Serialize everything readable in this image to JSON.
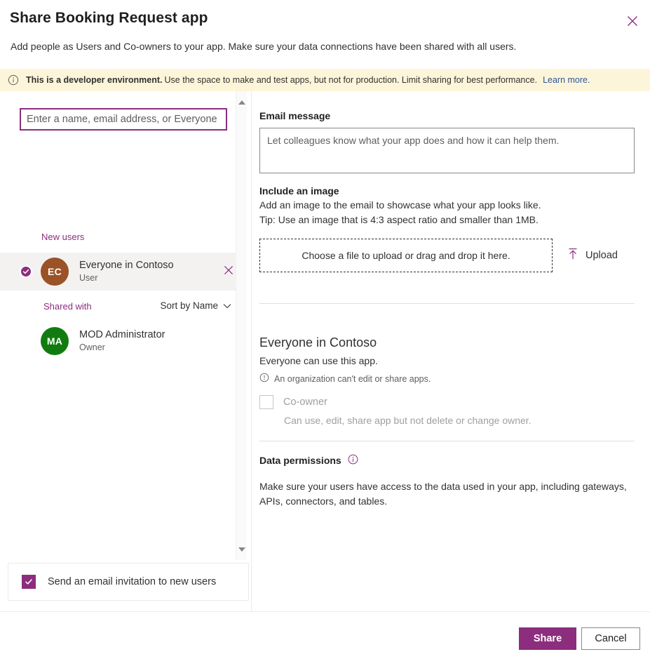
{
  "header": {
    "title": "Share Booking Request app",
    "subtitle": "Add people as Users and Co-owners to your app. Make sure your data connections have been shared with all users.",
    "close_icon": "close-icon"
  },
  "info_bar": {
    "icon": "info-icon",
    "strong_text": "This is a developer environment.",
    "text": "Use the space to make and test apps, but not for production. Limit sharing for best performance.",
    "link_label": "Learn more.",
    "background": "#fdf5d9",
    "link_color": "#2b579a"
  },
  "left_pane": {
    "people_input": {
      "value": "",
      "placeholder": "Enter a name, email address, or Everyone"
    },
    "new_users_label": "New users",
    "shared_with_label": "Shared with",
    "sort_label": "Sort by Name",
    "sort_icon": "chevron-down-icon",
    "new_users": [
      {
        "initials": "EC",
        "name": "Everyone in Contoso",
        "role": "User",
        "avatar_color": "#9a5227",
        "selected": true,
        "remove_icon": "close-icon"
      }
    ],
    "shared_users": [
      {
        "initials": "MA",
        "name": "MOD Administrator",
        "role": "Owner",
        "avatar_color": "#107c10"
      }
    ],
    "scrollbar": {
      "up_icon": "triangle-up-icon",
      "down_icon": "triangle-down-icon"
    },
    "invite_checkbox": {
      "label": "Send an email invitation to new users",
      "checked": true,
      "color": "#8c2d7e"
    }
  },
  "right_pane": {
    "email_message_label": "Email message",
    "email_message": {
      "value": "",
      "placeholder": "Let colleagues know what your app does and how it can help them."
    },
    "include_image_label": "Include an image",
    "include_image_line1": "Add an image to the email to showcase what your app looks like.",
    "include_image_line2": "Tip: Use an image that is 4:3 aspect ratio and smaller than 1MB.",
    "dropzone_label": "Choose a file to upload or drag and drop it here.",
    "upload_label": "Upload",
    "upload_icon": "upload-icon",
    "permission": {
      "title": "Everyone in Contoso",
      "subtitle": "Everyone can use this app.",
      "note_icon": "info-icon",
      "note": "An organization can't edit or share apps.",
      "coowner_label": "Co-owner",
      "coowner_checked": false,
      "coowner_description": "Can use, edit, share app but not delete or change owner."
    },
    "data_permissions": {
      "title": "Data permissions",
      "info_icon": "info-circle-icon",
      "body_line1": "Make sure your users have access to the data used in your app, including gateways,",
      "body_line2": "APIs, connectors, and tables."
    }
  },
  "footer": {
    "share_label": "Share",
    "cancel_label": "Cancel",
    "accent_color": "#8c2d7e"
  }
}
